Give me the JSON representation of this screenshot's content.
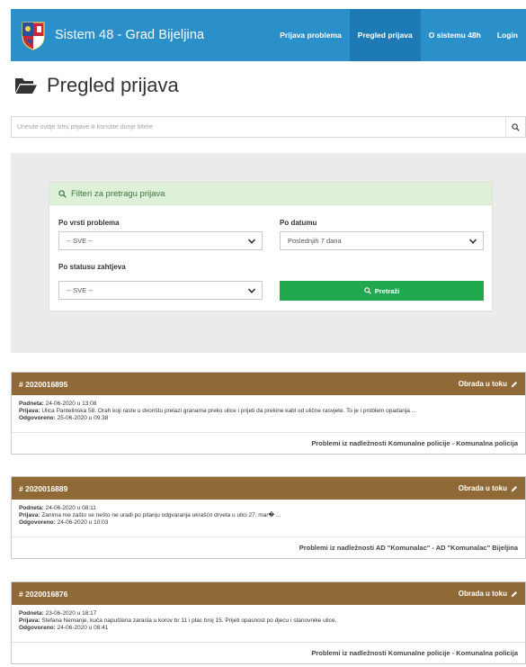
{
  "header": {
    "brand_title": "Sistem 48 - Grad Bijeljina",
    "nav": [
      {
        "label": "Prijava problema",
        "active": false
      },
      {
        "label": "Pregled prijava",
        "active": true
      },
      {
        "label": "O sistemu 48h",
        "active": false
      },
      {
        "label": "Login",
        "active": false
      }
    ],
    "colors": {
      "navbar": "#2b8fc9",
      "active": "#1e7ab4"
    }
  },
  "page": {
    "title": "Pregled prijava",
    "title_icon": "folder-open-icon"
  },
  "search": {
    "placeholder": "Unesite ovdje šifru prijave ili koristite donje filtere",
    "icon": "search-icon"
  },
  "filters": {
    "heading": "Filteri za pretragu prijava",
    "type_label": "Po vrsti problema",
    "type_value": "-- SVE --",
    "date_label": "Po datumu",
    "date_value": "Poslednjih 7 dana",
    "status_label": "Po statusu zahtjeva",
    "status_value": "-- SVE --",
    "search_button": "Pretraži",
    "colors": {
      "heading_bg": "#dff0d8",
      "button": "#21a84f"
    }
  },
  "reports": [
    {
      "id": "# 2020016895",
      "status": "Obrada u toku",
      "submitted_label": "Podneta:",
      "submitted": "24-06-2020 u 13:08",
      "report_label": "Prijava:",
      "report": "Ulica Pantelinska 58. Orah koji raste u dvorištu prelazi granama preko ulice i prijeti da prekine kabl od ulične rasvjete. To je i problem opadanja ...",
      "answered_label": "Odgovoreno:",
      "answered": "25-06-2020 u 09:38",
      "department": "Problemi iz nadležnosti Komunalne policije - Komunalna policija"
    },
    {
      "id": "# 2020016889",
      "status": "Obrada u toku",
      "submitted_label": "Podneta:",
      "submitted": "24-06-2020 u 08:11",
      "report_label": "Prijava:",
      "report": "Zanima me zašto se nešto ne uradi po pitanju odgvaranja ukrašćn drveta u ulici 27. mar� ...",
      "answered_label": "Odgovoreno:",
      "answered": "24-06-2020 u 10:03",
      "department": "Problemi iz nadležnosti AD \"Komunalac\" - AD \"Komunalac\" Bijeljina"
    },
    {
      "id": "# 2020016876",
      "status": "Obrada u toku",
      "submitted_label": "Podneta:",
      "submitted": "23-06-2020 u 18:17",
      "report_label": "Prijava:",
      "report": "Stefana Nemanje, kuća napuštena zarasla u korov br 11 i plac broj 15. Prijeti opasnost po djecu i stanovnike ulice.",
      "answered_label": "Odgovoreno:",
      "answered": "24-06-2020 u 08:41",
      "department": "Problemi iz nadležnosti Komunalne policije - Komunalna policija"
    }
  ],
  "card_colors": {
    "header": "#8f6a37"
  }
}
